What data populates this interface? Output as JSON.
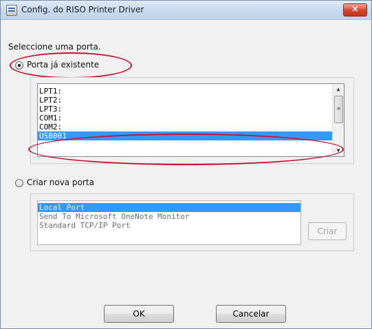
{
  "window": {
    "title": "Config. do RISO Printer Driver",
    "close_glyph": "×",
    "icon": "printer-driver-icon"
  },
  "prompt": "Seleccione uma porta.",
  "existing_port": {
    "label": "Porta já existente",
    "selected": true,
    "items": [
      "LPT1:",
      "LPT2:",
      "LPT3:",
      "COM1:",
      "COM2:",
      "USB001"
    ],
    "selected_item": "USB001"
  },
  "new_port": {
    "label": "Criar nova porta",
    "selected": false,
    "items": [
      "Local Port",
      "Send To Microsoft OneNote Monitor",
      "Standard TCP/IP Port"
    ],
    "selected_item": "Local Port",
    "create_label": "Criar"
  },
  "buttons": {
    "ok": "OK",
    "cancel": "Cancelar"
  },
  "colors": {
    "highlight": "#3399ff",
    "callout": "#c8102e",
    "close": "#c43417"
  }
}
